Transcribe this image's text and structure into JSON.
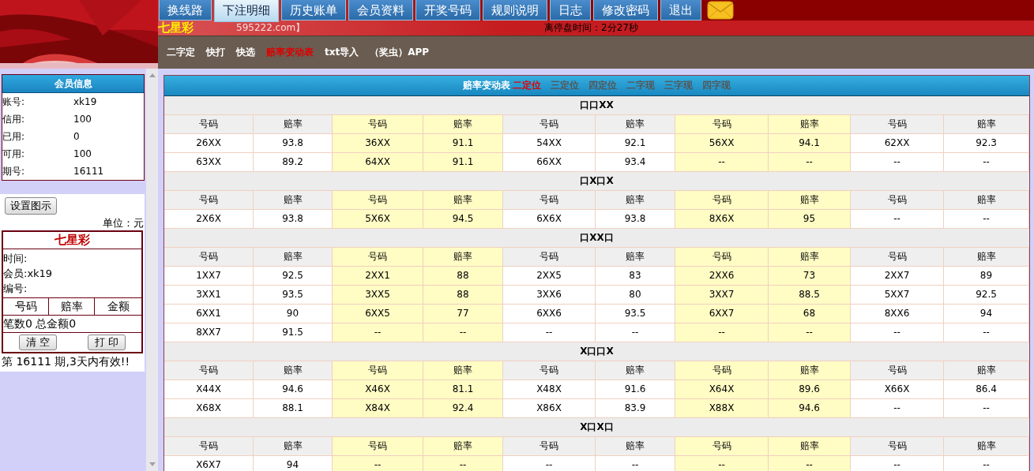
{
  "tabs": [
    {
      "label": "换线路",
      "selected": false
    },
    {
      "label": "下注明细",
      "selected": true
    },
    {
      "label": "历史账单",
      "selected": false
    },
    {
      "label": "会员资料",
      "selected": false
    },
    {
      "label": "开奖号码",
      "selected": false
    },
    {
      "label": "规则说明",
      "selected": false
    },
    {
      "label": "日志",
      "selected": false
    },
    {
      "label": "修改密码",
      "selected": false
    },
    {
      "label": "退出",
      "selected": false
    }
  ],
  "lottery_name": "七星彩",
  "site": "595222.com】",
  "countdown": "离停盘时间：2分27秒",
  "subnav": [
    {
      "label": "二字定",
      "selected": false
    },
    {
      "label": "快打",
      "selected": false
    },
    {
      "label": "快选",
      "selected": false
    },
    {
      "label": "赔率变动表",
      "selected": true
    },
    {
      "label": "txt导入",
      "selected": false
    },
    {
      "label": "（奖虫）APP",
      "selected": false
    }
  ],
  "member_info": {
    "title": "会员信息",
    "fields": [
      {
        "label": "账号:",
        "value": "xk19"
      },
      {
        "label": "信用:",
        "value": "100"
      },
      {
        "label": "已用:",
        "value": "0"
      },
      {
        "label": "可用:",
        "value": "100"
      },
      {
        "label": "期号:",
        "value": "16111"
      }
    ]
  },
  "settings_button": "设置图示",
  "unit": "单位：元",
  "ticket": {
    "title": "七星彩",
    "lines": [
      "时间:",
      "会员:xk19",
      "编号:"
    ],
    "columns": [
      "号码",
      "赔率",
      "金额"
    ],
    "summary": "笔数0 总金额0",
    "buttons": [
      "清 空",
      "打 印"
    ]
  },
  "validity": "第 16111 期,3天内有效!!",
  "odds_table": {
    "title": "赔率变动表",
    "filters": [
      {
        "label": "二定位",
        "selected": true
      },
      {
        "label": "三定位",
        "selected": false
      },
      {
        "label": "四定位",
        "selected": false
      },
      {
        "label": "二字现",
        "selected": false
      },
      {
        "label": "三字现",
        "selected": false
      },
      {
        "label": "四字现",
        "selected": false
      }
    ],
    "sections": [
      {
        "title": "口口XX",
        "header": [
          "号码",
          "赔率",
          "号码",
          "赔率",
          "号码",
          "赔率",
          "号码",
          "赔率",
          "号码",
          "赔率"
        ],
        "rows": [
          [
            "26XX",
            "93.8",
            "36XX",
            "91.1",
            "54XX",
            "92.1",
            "56XX",
            "94.1",
            "62XX",
            "92.3"
          ],
          [
            "63XX",
            "89.2",
            "64XX",
            "91.1",
            "66XX",
            "93.4",
            "--",
            "--",
            "--",
            "--"
          ]
        ]
      },
      {
        "title": "口X口X",
        "header": [
          "号码",
          "赔率",
          "号码",
          "赔率",
          "号码",
          "赔率",
          "号码",
          "赔率",
          "号码",
          "赔率"
        ],
        "rows": [
          [
            "2X6X",
            "93.8",
            "5X6X",
            "94.5",
            "6X6X",
            "93.8",
            "8X6X",
            "95",
            "--",
            "--"
          ]
        ]
      },
      {
        "title": "口XX口",
        "header": [
          "号码",
          "赔率",
          "号码",
          "赔率",
          "号码",
          "赔率",
          "号码",
          "赔率",
          "号码",
          "赔率"
        ],
        "rows": [
          [
            "1XX7",
            "92.5",
            "2XX1",
            "88",
            "2XX5",
            "83",
            "2XX6",
            "73",
            "2XX7",
            "89"
          ],
          [
            "3XX1",
            "93.5",
            "3XX5",
            "88",
            "3XX6",
            "80",
            "3XX7",
            "88.5",
            "5XX7",
            "92.5"
          ],
          [
            "6XX1",
            "90",
            "6XX5",
            "77",
            "6XX6",
            "93.5",
            "6XX7",
            "68",
            "8XX6",
            "94"
          ],
          [
            "8XX7",
            "91.5",
            "--",
            "--",
            "--",
            "--",
            "--",
            "--",
            "--",
            "--"
          ]
        ]
      },
      {
        "title": "X口口X",
        "header": [
          "号码",
          "赔率",
          "号码",
          "赔率",
          "号码",
          "赔率",
          "号码",
          "赔率",
          "号码",
          "赔率"
        ],
        "rows": [
          [
            "X44X",
            "94.6",
            "X46X",
            "81.1",
            "X48X",
            "91.6",
            "X64X",
            "89.6",
            "X66X",
            "86.4"
          ],
          [
            "X68X",
            "88.1",
            "X84X",
            "92.4",
            "X86X",
            "83.9",
            "X88X",
            "94.6",
            "--",
            "--"
          ]
        ]
      },
      {
        "title": "X口X口",
        "header": [
          "号码",
          "赔率",
          "号码",
          "赔率",
          "号码",
          "赔率",
          "号码",
          "赔率",
          "号码",
          "赔率"
        ],
        "rows": [
          [
            "X6X7",
            "94",
            "--",
            "--",
            "--",
            "--",
            "--",
            "--",
            "--",
            "--"
          ]
        ]
      }
    ]
  }
}
